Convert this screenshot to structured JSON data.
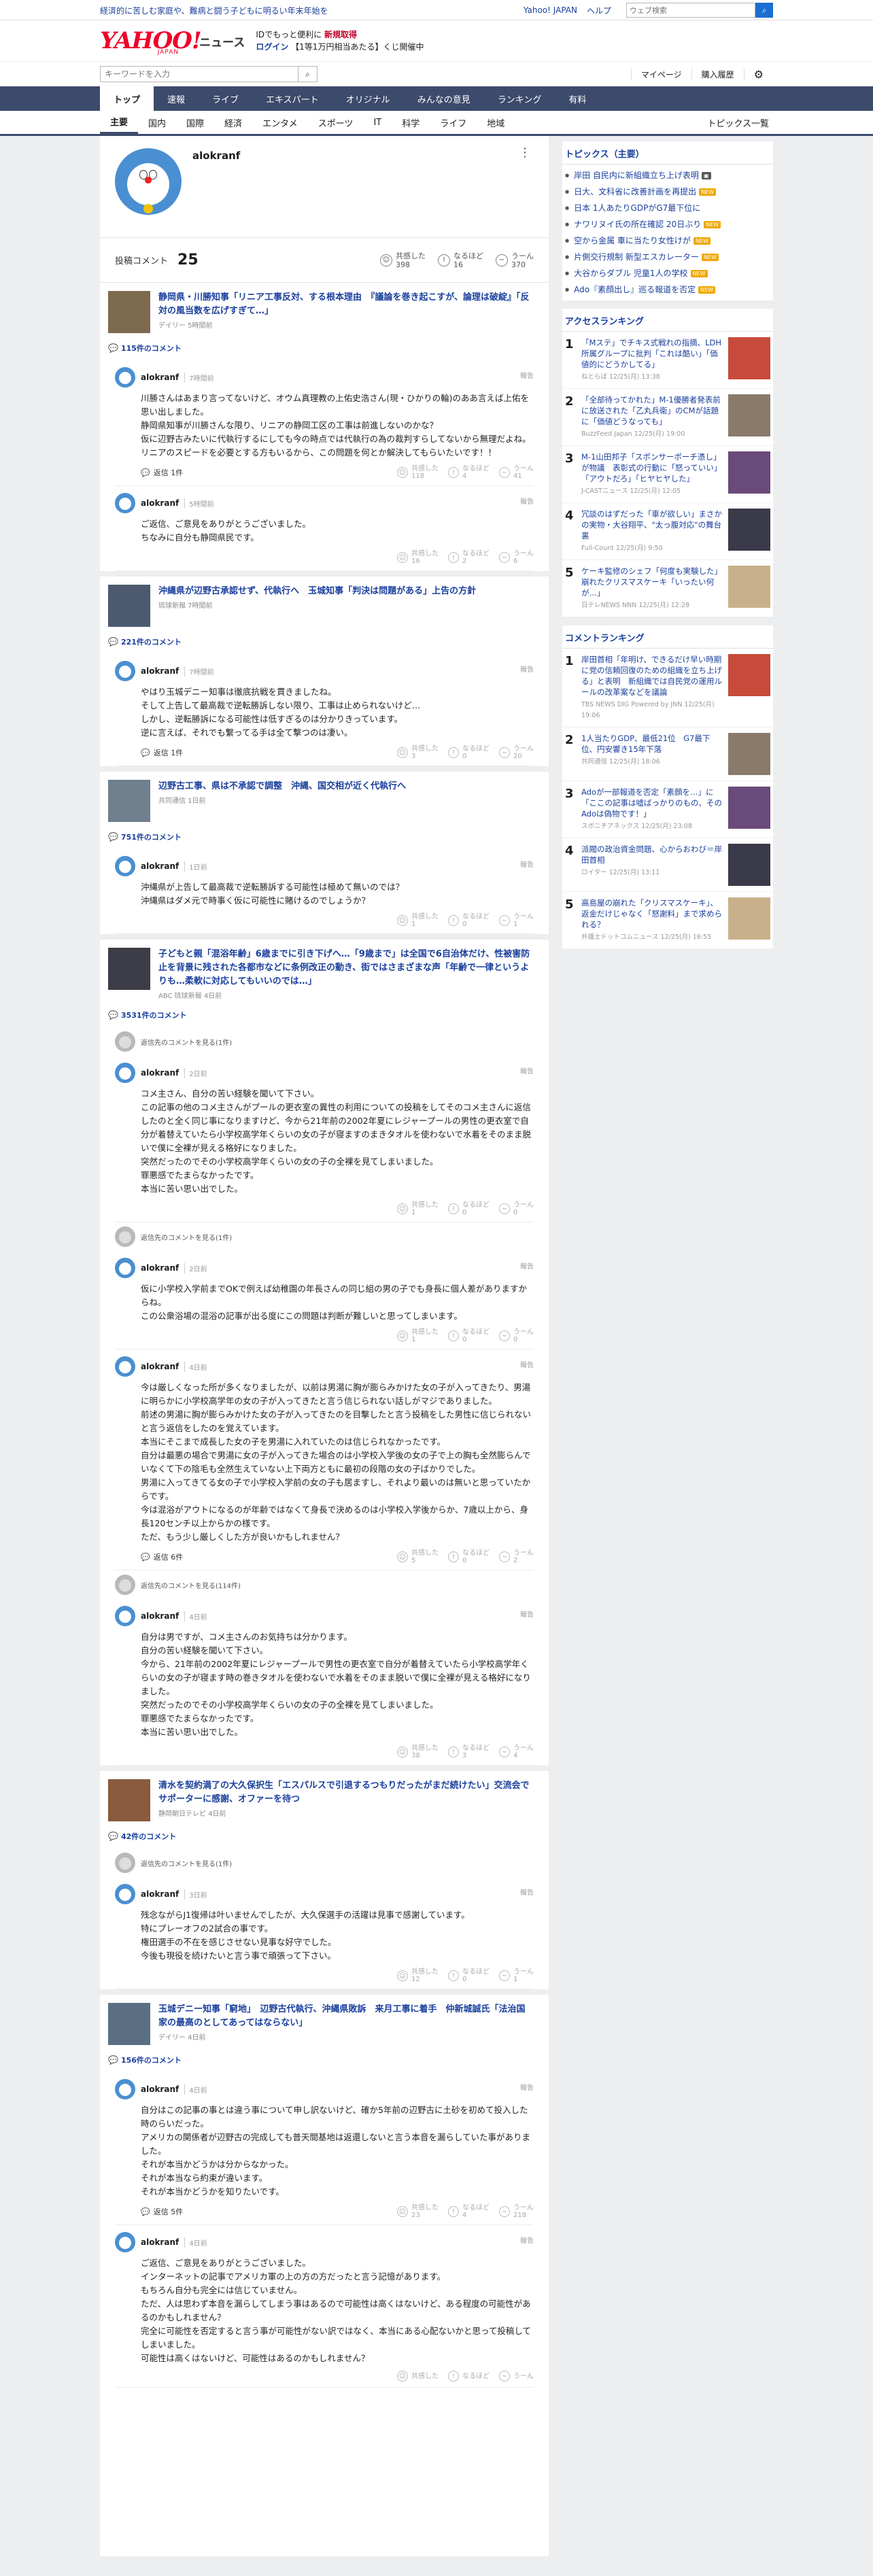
{
  "topbar": {
    "promo": "経済的に苦しむ家庭や、難病と闘う子どもに明るい年末年始を",
    "links": [
      "Yahoo! JAPAN",
      "ヘルプ"
    ],
    "search_placeholder": "ウェブ検索"
  },
  "header": {
    "logo": "YAHOO!",
    "logo_sub": "JAPAN",
    "service": "ニュース",
    "msg_line1_a": "IDでもっと便利に",
    "msg_line1_b": "新規取得",
    "msg_line2_a": "ログイン",
    "msg_line2_b": "【1等1万円相当あたる】くじ開催中",
    "kw_placeholder": "キーワードを入力",
    "mypage": "マイページ",
    "plan": "購入履歴"
  },
  "gnav": [
    "トップ",
    "速報",
    "ライブ",
    "エキスパート",
    "オリジナル",
    "みんなの意見",
    "ランキング",
    "有料"
  ],
  "snav": [
    "主要",
    "国内",
    "国際",
    "経済",
    "エンタメ",
    "スポーツ",
    "IT",
    "科学",
    "ライフ",
    "地域"
  ],
  "snav_all": "トピックス一覧",
  "profile": {
    "name": "alokranf",
    "comment_label": "投稿コメント",
    "comment_count": "25",
    "r1_label": "共感した",
    "r1": "398",
    "r2_label": "なるほど",
    "r2": "16",
    "r3_label": "うーん",
    "r3": "370"
  },
  "labels": {
    "reply": "返信",
    "report": "報告",
    "kyokan": "共感した",
    "naruhodo": "なるほど",
    "uun": "うーん"
  },
  "threads": [
    {
      "title": "静岡県・川勝知事「リニア工事反対、する根本理由　『議論を巻き起こすが、論理は破綻』「反対の風当数を広げすぎて…」",
      "src": "デイリー 5時間前",
      "count": "115件のコメント",
      "comments": [
        {
          "name": "alokranf",
          "time": "7時間前",
          "body": "川勝さんはあまり言ってないけど、オウム真理教の上佑史浩さん(現・ひかりの輪)のああ言えば上佑を思い出しました。\n静岡県知事が川勝さんな限り、リニアの静岡工区の工事は前進しないのかな？\n仮に辺野古みたいに代執行するにしても今の時点では代執行の為の裁判すらしてないから無理だよね。\nリニアのスピードを必要とする方もいるから、この問題を何とか解決してもらいたいです！！",
          "reply": "返信 1件",
          "r1": "118",
          "r2": "4",
          "r3": "41"
        },
        {
          "name": "alokranf",
          "time": "5時間前",
          "body": "ご返信、ご意見をありがとうございました。\nちなみに自分も静岡県民です。",
          "reply": "",
          "r1": "16",
          "r2": "2",
          "r3": "6"
        }
      ]
    },
    {
      "title": "沖縄県が辺野古承認せず、代執行へ　玉城知事「判決は問題がある」上告の方針",
      "src": "琉球新報 7時間前",
      "count": "221件のコメント",
      "comments": [
        {
          "name": "alokranf",
          "time": "7時間前",
          "body": "やはり玉城デニー知事は徹底抗戦を貫きましたね。\nそして上告して最高裁で逆転勝訴しない限り、工事は止められないけど…\nしかし、逆転勝訴になる可能性は低すぎるのは分かりきっています。\n逆に言えば、それでも繋ってる手は全て撃つのは凄い。",
          "reply": "返信 1件",
          "r1": "3",
          "r2": "0",
          "r3": "20"
        }
      ]
    },
    {
      "title": "辺野古工事、県は不承認で調整　沖縄、国交相が近く代執行へ",
      "src": "共同通信 1日前",
      "count": "751件のコメント",
      "comments": [
        {
          "name": "alokranf",
          "time": "1日前",
          "body": "沖縄県が上告して最高裁で逆転勝訴する可能性は極めて無いのでは？\n沖縄県はダメ元で時事く仮に可能性に賭けるのでしょうか？",
          "reply": "",
          "r1": "1",
          "r2": "0",
          "r3": "1"
        }
      ]
    },
    {
      "title": "子どもと親「混浴年齢」6歳までに引き下げへ…「9歳まで」は全国で6自治体だけ、性被害防止を背景に残された各都市などに条例改正の動き、街ではさまざまな声「年齢で一律というよりも…柔軟に対応してもいいのでは…」",
      "src": "ABC 琉球新報 4日前",
      "count": "3531件のコメント",
      "comments": [
        {
          "replyhdr": "返信先のコメントを見る(1件)",
          "name": "alokranf",
          "time": "2日前",
          "body": "コメ主さん、自分の苦い経験を聞いて下さい。\nこの記事の他のコメ主さんがプールの更衣室の異性の利用についての投稿をしてそのコメ主さんに返信したのと全く同じ事になりますけど、今から21年前の2002年夏にレジャープールの男性の更衣室で自分が着替えていたら小学校高学年くらいの女の子が寝ますのまきタオルを使わないで水着をそのまま脱いで僕に全裸が見える格好になりました。\n突然だったのでその小学校高学年くらいの女の子の全裸を見てしまいました。\n罪悪感でたまらなかったです。\n本当に苦い思い出でした。",
          "reply": "",
          "r1": "1",
          "r2": "0",
          "r3": "0"
        },
        {
          "replyhdr": "返信先のコメントを見る(1件)",
          "name": "alokranf",
          "time": "2日前",
          "body": "仮に小学校入学前までOKで例えば幼稚園の年長さんの同じ組の男の子でも身長に個人差がありますからね。\nこの公衆浴場の混浴の記事が出る度にこの問題は判断が難しいと思ってしまいます。",
          "reply": "",
          "r1": "1",
          "r2": "0",
          "r3": "0"
        },
        {
          "name": "alokranf",
          "time": "4日前",
          "body": "今は厳しくなった所が多くなりましたが、以前は男湯に胸が膨らみかけた女の子が入ってきたり、男湯に明らかに小学校高学年の女の子が入ってきたと言う信じられない話しがマジでありました。\n前述の男湯に胸が膨らみかけた女の子が入ってきたのを目撃したと言う投稿をした男性に信じられないと言う返信をしたのを覚えています。\n本当にそこまで成長した女の子を男湯に入れていたのは信じられなかったです。\n自分は最悪の場合で男湯に女の子が入ってきた場合のは小学校入学後の女の子で上の胸も全然膨らんでいなくて下の陰毛も全然生えていない上下両方ともに最初の段階の女の子ばかりでした。\n男湯に入ってきてる女の子で小学校入学前の女の子も居ますし、それより最いのは無いと思っていたからです。\n今は混浴がアウトになるのが年齢ではなくて身長で決めるのは小学校入学後からか、7歳以上から、身長120センチ以上からかの様です。\nただ、もう少し厳しくした方が良いかもしれません？",
          "reply": "返信 6件",
          "r1": "5",
          "r2": "0",
          "r3": "2"
        },
        {
          "replyhdr": "返信先のコメントを見る(114件)",
          "name": "alokranf",
          "time": "4日前",
          "body": "自分は男ですが、コメ主さんのお気持ちは分かります。\n自分の苦い経験を聞いて下さい。\n今から、21年前の2002年夏にレジャープールで男性の更衣室で自分が着替えていたら小学校高学年くらいの女の子が寝ます時の巻きタオルを使わないで水着をそのまま脱いで僕に全裸が見える格好になりました。\n突然だったのでその小学校高学年くらいの女の子の全裸を見てしまいました。\n罪悪感でたまらなかったです。\n本当に苦い思い出でした。",
          "reply": "",
          "r1": "38",
          "r2": "3",
          "r3": "4"
        }
      ]
    },
    {
      "title": "清水を契約満了の大久保択生「エスパルスで引退するつもりだったがまだ続けたい」交流会でサポーターに感謝、オファーを待つ",
      "src": "静岡朝日テレビ 4日前",
      "count": "42件のコメント",
      "comments": [
        {
          "replyhdr": "返信先のコメントを見る(1件)",
          "name": "alokranf",
          "time": "3日前",
          "body": "残念ながらJ1復帰は叶いませんでしたが、大久保選手の活躍は見事で感謝しています。\n特にプレーオフの2試合の事です。\n権田選手の不在を感じさせない見事な好守でした。\n今後も現役を続けたいと言う事で頑張って下さい。",
          "reply": "",
          "r1": "12",
          "r2": "0",
          "r3": "1"
        }
      ]
    },
    {
      "title": "玉城デニー知事「窮地」　辺野古代執行、沖縄県敗訴　来月工事に着手　仲新城誠氏「法治国家の最高のとしてあってはならない」",
      "src": "デイリー 4日前",
      "count": "156件のコメント",
      "comments": [
        {
          "name": "alokranf",
          "time": "4日前",
          "body": "自分はこの記事の事とは違う事について申し訳ないけど、確か5年前の辺野古に土砂を初めて投入した時のらいだった。\nアメリカの関係者が辺野古の完成しても普天間基地は返還しないと言う本音を漏らしていた事がありました。\nそれが本当かどうかは分からなかった。\nそれが本当なら約束が違います。\nそれが本当かどうかを知りたいです。",
          "reply": "返信 5件",
          "r1": "23",
          "r2": "4",
          "r3": "218"
        },
        {
          "name": "alokranf",
          "time": "4日前",
          "body": "ご返信、ご意見をありがとうございました。\nインターネットの記事でアメリカ軍の上の方の方だったと言う記憶があります。\nもちろん自分も完全には信じていません。\nただ、人は思わず本音を漏らしてしまう事はあるので可能性は高くはないけど、ある程度の可能性があるのかもしれません？\n完全に可能性を否定すると言う事が可能性がない訳ではなく、本当にある心配ないかと思って投稿してしまいました。\n可能性は高くはないけど、可能性はあるのかもしれません？",
          "reply": "",
          "r1": "",
          "r2": "",
          "r3": ""
        }
      ]
    }
  ],
  "side": {
    "topics_title": "トピックス（主要）",
    "topics": [
      {
        "t": "岸田 自民内に新組織立ち上げ表明",
        "b": "img"
      },
      {
        "t": "日大、文科省に改善計画を再提出",
        "b": "new"
      },
      {
        "t": "日本 1人あたりGDPがG7最下位に",
        "b": ""
      },
      {
        "t": "ナワリヌイ氏の所在確認 20日ぶり",
        "b": "new"
      },
      {
        "t": "空から金属 車に当たり女性けが",
        "b": "new"
      },
      {
        "t": "片側交行規制 新型エスカレーター",
        "b": "new"
      },
      {
        "t": "大谷からダブル 児童1人の学校",
        "b": "new"
      },
      {
        "t": "Ado『素顔出し』巡る報道を否定",
        "b": "new"
      }
    ],
    "access_title": "アクセスランキング",
    "access": [
      {
        "t": "「Mステ」でチキス式戦れの指摘、LDH所属グループに批判「これは酷い」「価値的にどうかしてる」",
        "m": "ねとらぼ 12/25(月) 13:38"
      },
      {
        "t": "「全部待ってかれた」M-1優勝者発表前に放送された「乙丸兵衛」のCMが話題に「価値どうなっても」",
        "m": "BuzzFeed Japan 12/25(月) 19:00"
      },
      {
        "t": "M-1山田邦子「スポンサーポーチ憑し」が物議　表彰式の行動に「怒っていい」「アウトだろ」「ヒヤヒヤした」",
        "m": "J-CASTニュース 12/25(月) 12:05"
      },
      {
        "t": "冗談のはずだった「車が欲しい」まさかの実物・大谷翔平、\"太っ腹対応\"の舞台裏",
        "m": "Full-Count 12/25(月) 9:50"
      },
      {
        "t": "ケーキ監修のシェフ「何度も実験した」　崩れたクリスマスケーキ「いったい何が…」",
        "m": "日テレNEWS NNN 12/25(月) 12:28"
      }
    ],
    "comment_title": "コメントランキング",
    "comments": [
      {
        "t": "岸田首相「年明け、できるだけ早い時期に党の信頼回復のための組織を立ち上げる」と表明　新組織では自民党の運用ルールの改革案などを議論",
        "m": "TBS NEWS DIG Powered by JNN 12/25(月) 19:06"
      },
      {
        "t": "1人当たりGDP、最低21位　G7最下位、円安響き15年下落",
        "m": "共同通信 12/25(月) 18:06"
      },
      {
        "t": "Adoが一部報道を否定「素顔を…」に「ここの記事は嘘ばっかりのもの、そのAdoは偽物です！」",
        "m": "スポニチアネックス 12/25(月) 23:08"
      },
      {
        "t": "派閥の政治資金問題、心からおわび＝岸田首相",
        "m": "ロイター 12/25(月) 13:11"
      },
      {
        "t": "高島屋の崩れた「クリスマスケーキ」、返金だけじゃなく「怒謝料」まで求められる？",
        "m": "弁護士ドットコムニュース 12/25(月) 16:55"
      }
    ]
  },
  "colors": {
    "nav": "#3c4a6b",
    "link": "#1a3f9d",
    "logo": "#f0002a",
    "badge": "#f0a800"
  }
}
